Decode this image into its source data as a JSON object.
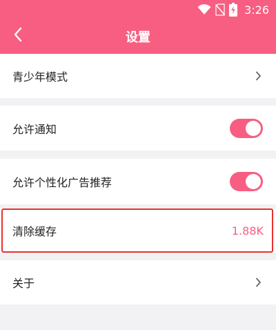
{
  "status_bar": {
    "time": "3:26",
    "icons": [
      "wifi-icon",
      "no-sim-icon",
      "battery-charging-icon"
    ]
  },
  "app_bar": {
    "back_icon": "chevron-left-icon",
    "title": "设置"
  },
  "settings": {
    "teen_mode": {
      "label": "青少年模式",
      "icon": "chevron-right-icon"
    },
    "allow_notifications": {
      "label": "允许通知",
      "enabled": true
    },
    "personalized_ads": {
      "label": "允许个性化广告推荐",
      "enabled": true
    },
    "clear_cache": {
      "label": "清除缓存",
      "value": "1.88K"
    },
    "about": {
      "label": "关于",
      "icon": "chevron-right-icon"
    }
  },
  "colors": {
    "accent": "#f75e82",
    "highlight_border": "#e8312f",
    "background": "#f2f2f4"
  }
}
